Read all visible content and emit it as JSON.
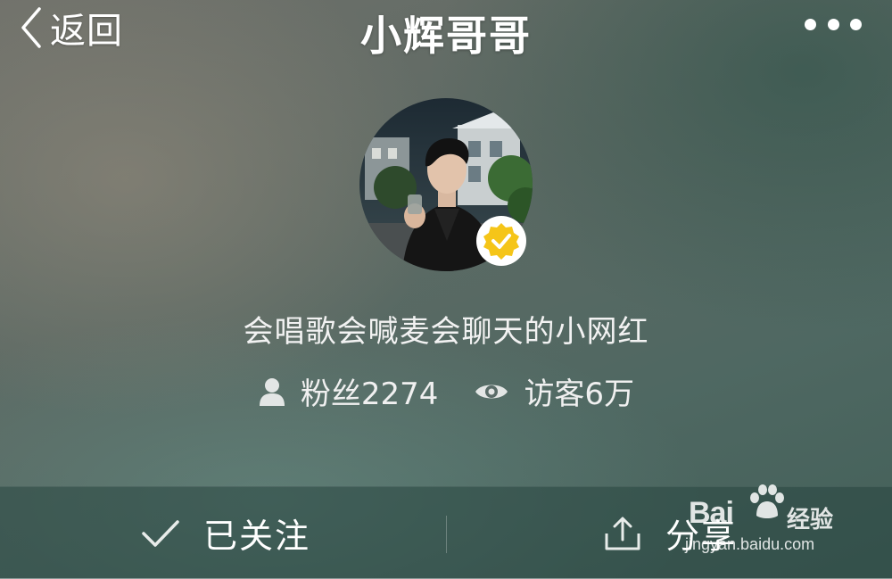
{
  "header": {
    "back_label": "返回",
    "title": "小辉哥哥",
    "more_icon": "more-dots-icon"
  },
  "profile": {
    "avatar": "profile-photo",
    "verified_icon": "verified-check-icon",
    "verified_color": "#f5c518",
    "bio": "会唱歌会喊麦会聊天的小网红",
    "fans_icon": "person-icon",
    "fans_label": "粉丝2274",
    "visitors_icon": "eye-icon",
    "visitors_label": "访客6万"
  },
  "actions": {
    "follow_icon": "checkmark-icon",
    "follow_label": "已关注",
    "share_icon": "share-upload-icon",
    "share_label": "分享"
  },
  "watermark": {
    "brand": "Bai",
    "tag": "经验",
    "url": "jingyan.baidu.com"
  }
}
